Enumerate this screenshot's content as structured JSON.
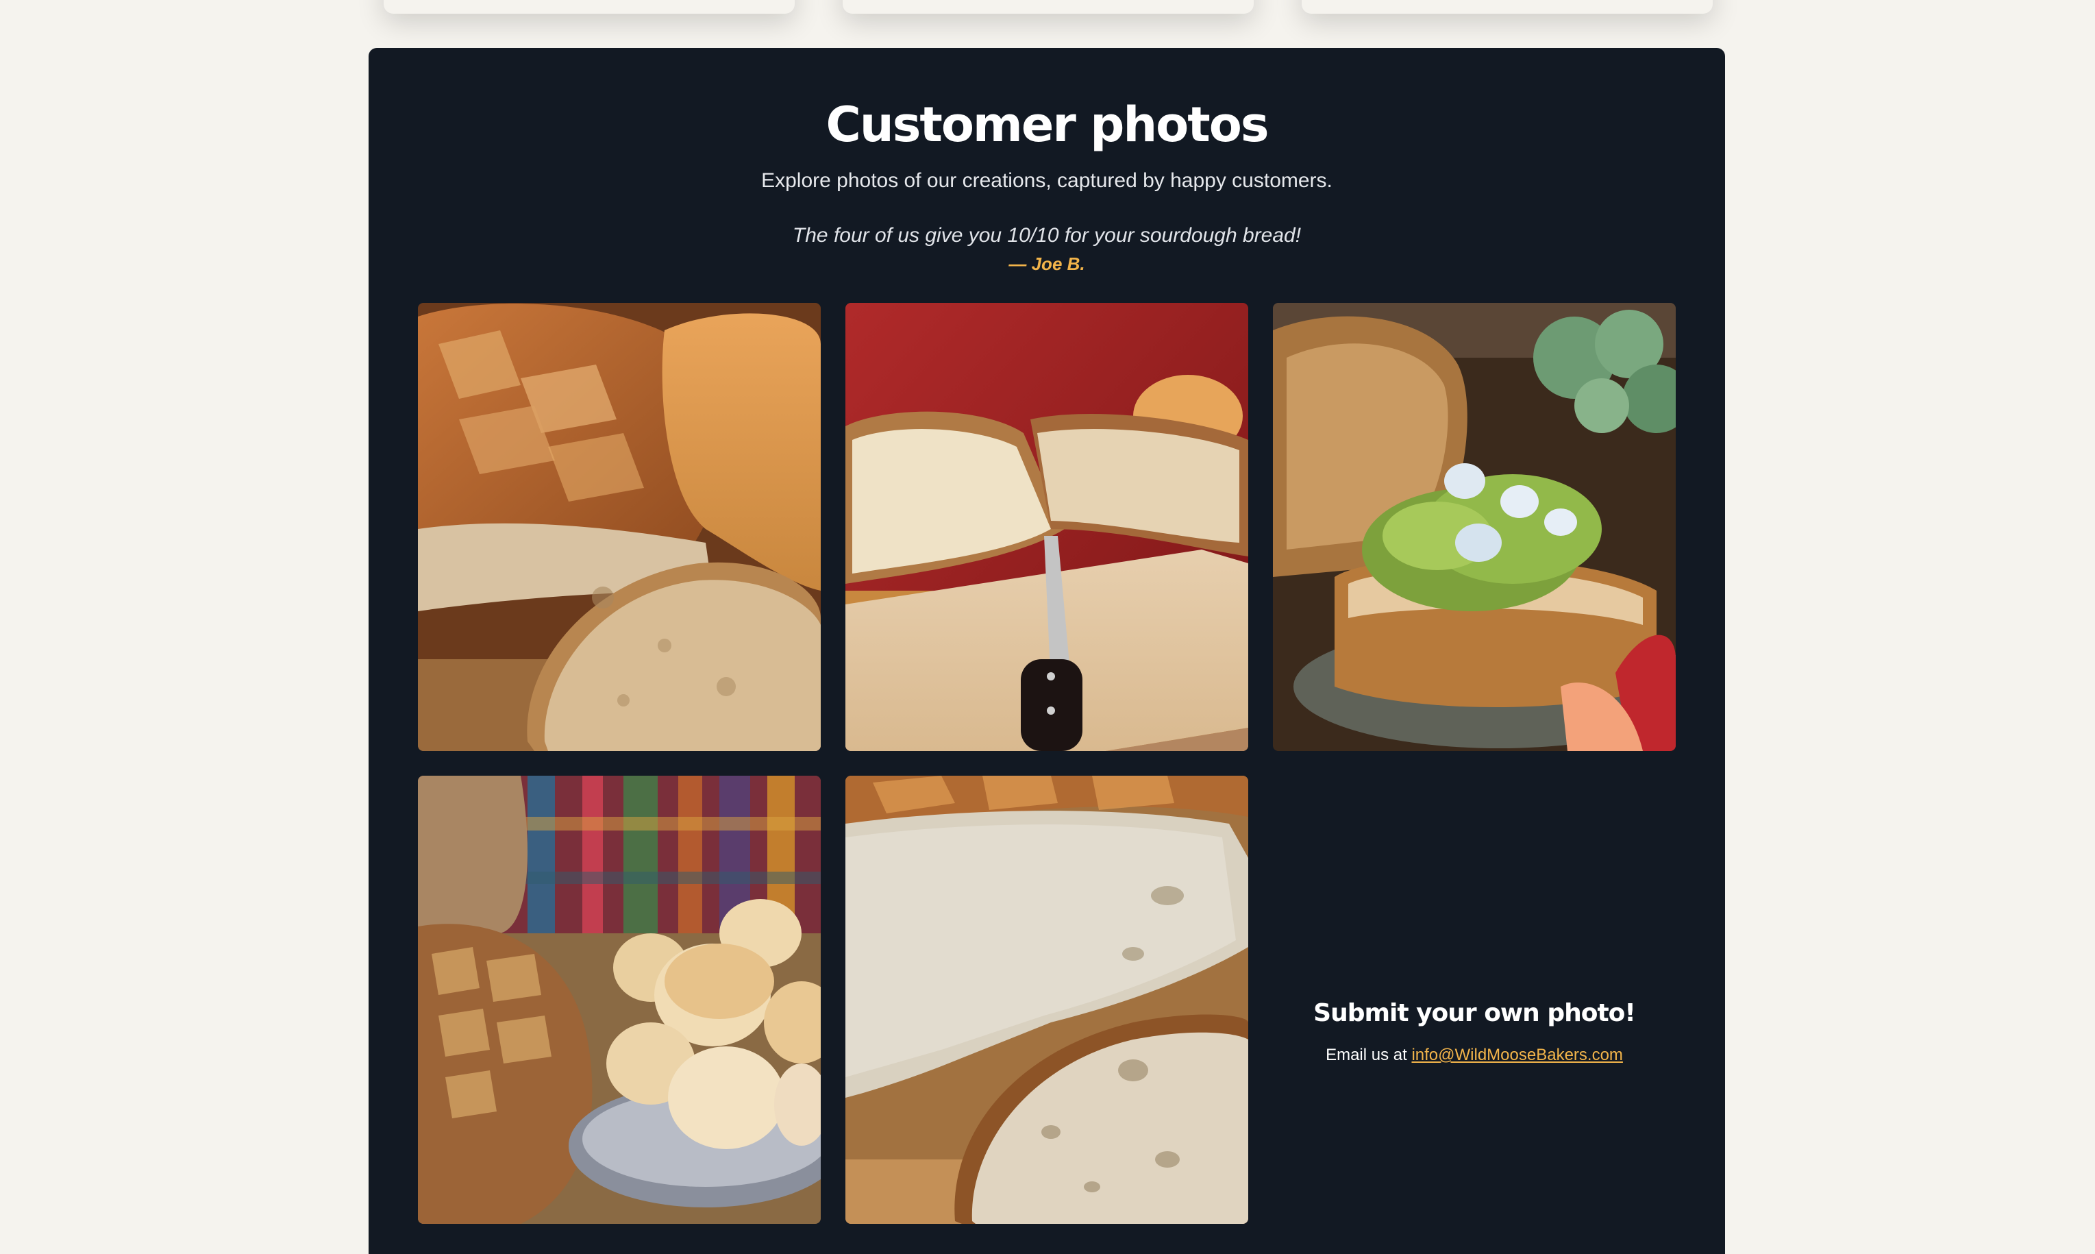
{
  "gallery": {
    "title": "Customer photos",
    "subtitle": "Explore photos of our creations, captured by happy customers.",
    "testimonial": {
      "quote": "The four of us give you 10/10 for your sourdough bread!",
      "author": "— Joe B."
    },
    "photos": [
      {
        "icon": "sourdough-loaves-photo"
      },
      {
        "icon": "sliced-bread-cutting-board-photo"
      },
      {
        "icon": "avocado-toast-photo"
      },
      {
        "icon": "bread-and-rolls-basket-photo"
      },
      {
        "icon": "sliced-sourdough-closeup-photo"
      }
    ],
    "submit": {
      "title": "Submit your own photo!",
      "prefix": "Email us at",
      "email": "info@WildMooseBakers.com"
    }
  },
  "colors": {
    "page_bg": "#f5f3ee",
    "panel_bg": "#121923",
    "accent": "#f2b44a",
    "text": "#ffffff"
  }
}
